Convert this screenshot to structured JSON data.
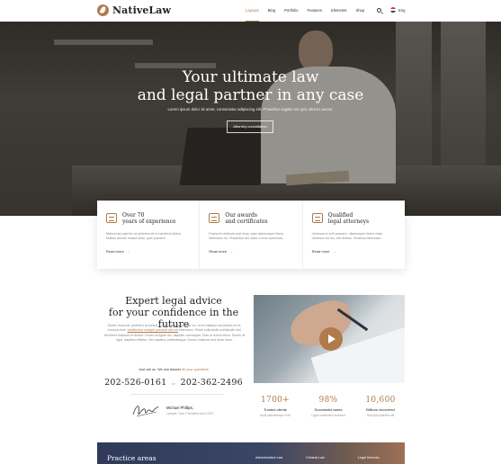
{
  "header": {
    "logo_text": "NativeLaw",
    "nav": [
      "Layouts",
      "Blog",
      "Portfolio",
      "Features",
      "Elements",
      "Shop"
    ],
    "active_nav": "Layouts",
    "language": "Eng"
  },
  "hero": {
    "title_line1": "Your ultimate law",
    "title_line2": "and legal partner in any case",
    "subtitle": "Lorem ipsum dolor sit amet, consectetur adipiscing elit. Phasellus sagittis est quis ultrices auctor.",
    "button": "Attorney consultation"
  },
  "features": [
    {
      "title_line1": "Over 70",
      "title_line2": "years of experience",
      "text": "Maecenas eget leo et pharetra sit ut hendrerit dictus. Nullam dictum massa dolor, quis posuere.",
      "link": "Read more",
      "icon": "calendar-icon"
    },
    {
      "title_line1": "Our awards",
      "title_line2": "and certificates",
      "text": "Praesent vehicula erat risus, eget ullamcorper libero bibendum eu. Phasellus nec dolor a eros commodo.",
      "link": "Read more",
      "icon": "certificate-icon"
    },
    {
      "title_line1": "Qualified",
      "title_line2": "legal attorneys",
      "text": "Vivamus ut velit posuere, ullamcorper libero vitae. Vivamus vel leo, nec finibus. Vivamus bibendum.",
      "link": "Read more",
      "icon": "scales-icon"
    }
  ],
  "about": {
    "title_line1": "Expert legal advice",
    "title_line2": "for your confidence in the future",
    "text_before": "Donec risus est, pharetra at cursus a, egestas ullamcorper eu. In eu tristique accumsan ex et, rhoncus erat.",
    "text_link": "Vestibulum suscipit posuere nisl vel",
    "text_after": "bibendum. Etiam sollicitudin sollicitudin nisl, hendrerit tincidunt et auctor. Donec at ligula dui, aliquam consequat. Duis ut lectus tellus. Donec at eget, dapibus efficitur. Sed dapibus pellentesque. Donec euismod sed dolor risus.",
    "call_prefix": "Just call us.",
    "call_text": "We can answer",
    "call_link": "all your questions",
    "phone1": "202-526-0161",
    "phone_or": "or",
    "phone2": "202-362-2496",
    "person_name": "Michael Phillips,",
    "person_role": "Lawyer, Vice President and CEO"
  },
  "stats": [
    {
      "number": "1700+",
      "label": "Trusted clients",
      "sub": "Nulla pellentesque ut tel"
    },
    {
      "number": "98%",
      "label": "Successful cases",
      "sub": "Ligula vestibulum euismod"
    },
    {
      "number": "10,600",
      "label": "Billions recovered",
      "sub": "Sed quis pharetra elit"
    }
  ],
  "practice": {
    "title": "Practice areas",
    "items": [
      "Administrative Law",
      "Criminal Law",
      "Legal Services"
    ]
  },
  "colors": {
    "accent": "#b07a4b",
    "dark": "#222222",
    "navy": "#2f3a5a"
  }
}
